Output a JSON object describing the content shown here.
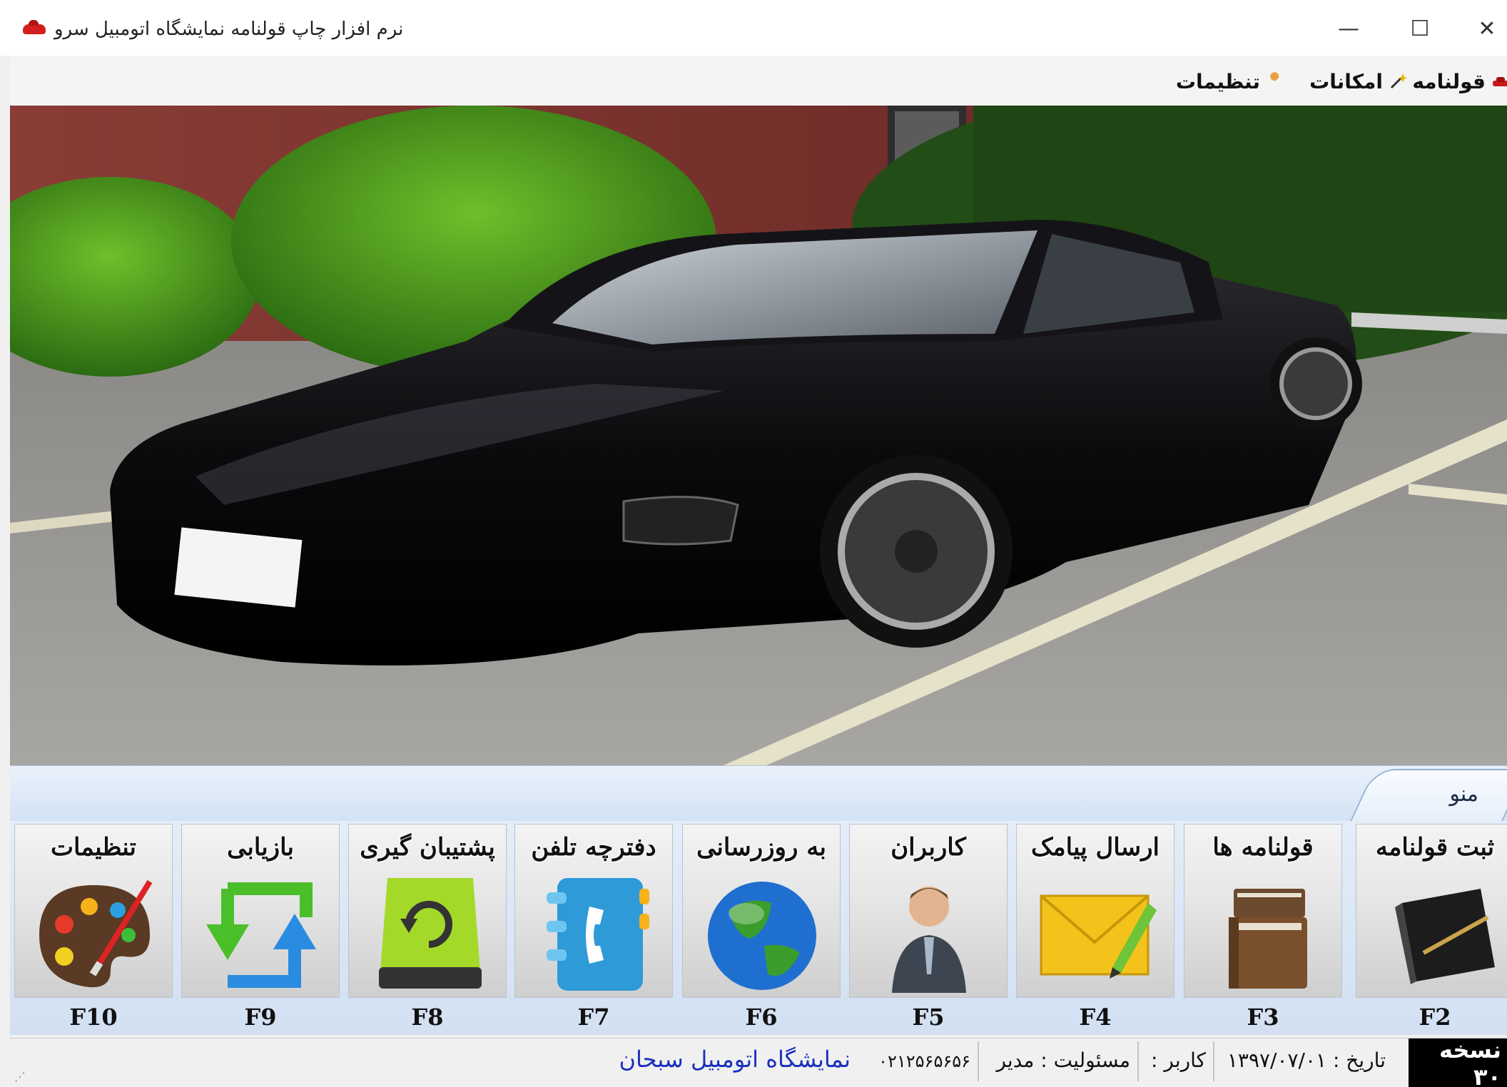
{
  "window": {
    "title": "نرم افزار چاپ قولنامه نمایشگاه اتومبیل سرو",
    "controls": {
      "close": "✕",
      "maximize": "☐",
      "minimize": "—"
    }
  },
  "menu": {
    "items": [
      {
        "label": "قولنامه",
        "icon": "car-icon"
      },
      {
        "label": "امکانات",
        "icon": "magic-wand-icon"
      },
      {
        "label": "تنظیمات",
        "icon": "wrench-icon"
      }
    ]
  },
  "tab": {
    "label": "منو"
  },
  "ribbon": {
    "buttons": [
      {
        "label": "ثبت قولنامه",
        "key": "F2",
        "icon": "notebook-pen-icon"
      },
      {
        "label": "قولنامه ها",
        "key": "F3",
        "icon": "books-icon"
      },
      {
        "label": "ارسال پیامک",
        "key": "F4",
        "icon": "envelope-pencil-icon"
      },
      {
        "label": "کاربران",
        "key": "F5",
        "icon": "user-icon"
      },
      {
        "label": "به روزرسانی",
        "key": "F6",
        "icon": "globe-icon"
      },
      {
        "label": "دفترچه تلفن",
        "key": "F7",
        "icon": "phonebook-icon"
      },
      {
        "label": "پشتیبان گیری",
        "key": "F8",
        "icon": "backup-drive-icon"
      },
      {
        "label": "بازیابی",
        "key": "F9",
        "icon": "restore-arrows-icon"
      },
      {
        "label": "تنظیمات",
        "key": "F10",
        "icon": "palette-icon"
      }
    ]
  },
  "status": {
    "version": "نسخه ۳۰",
    "date": "تاریخ : ۱۳۹۷/۰۷/۰۱",
    "user": "کاربر :",
    "role": "مسئولیت : مدیر",
    "phone": "۰۲۱۲۵۶۵۶۵۶",
    "business": "نمایشگاه اتومبیل سبحان"
  },
  "colors": {
    "tab_border": "#8fb0d9",
    "business_name": "#1a2fbf",
    "version_bg": "#000000"
  }
}
